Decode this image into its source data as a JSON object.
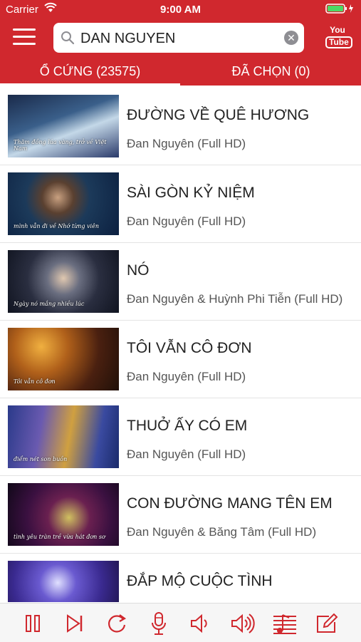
{
  "status": {
    "carrier": "Carrier",
    "time": "9:00 AM"
  },
  "header": {
    "search_value": "DAN NGUYEN",
    "youtube_top": "You",
    "youtube_bottom": "Tube"
  },
  "tabs": [
    {
      "label": "Ổ CỨNG (23575)"
    },
    {
      "label": "ĐÃ CHỌN (0)"
    }
  ],
  "songs": [
    {
      "title": "ĐƯỜNG VỀ QUÊ HƯƠNG",
      "artist": "Đan Nguyên (Full HD)",
      "subtitle": "Thăm đồng lúa vàng, trở về Việt Nam"
    },
    {
      "title": "SÀI GÒN KỶ NIỆM",
      "artist": "Đan Nguyên (Full HD)",
      "subtitle": "mình vẫn đi về  Nhớ từng viên"
    },
    {
      "title": "NÓ",
      "artist": "Đan Nguyên & Huỳnh Phi Tiễn (Full HD)",
      "subtitle": "Ngày nó  mắng nhiều lúc"
    },
    {
      "title": "TÔI VẪN CÔ ĐƠN",
      "artist": "Đan Nguyên (Full HD)",
      "subtitle": "Tôi vẫn cô đơn"
    },
    {
      "title": "THUỞ ẤY CÓ EM",
      "artist": "Đan Nguyên (Full HD)",
      "subtitle": "điểm nét son buồn"
    },
    {
      "title": "CON ĐƯỜNG MANG TÊN EM",
      "artist": "Đan Nguyên & Băng Tâm (Full HD)",
      "subtitle": "tình yêu tràn trề  vừa hát đơn sơ"
    },
    {
      "title": "ĐẮP MỘ CUỘC TÌNH",
      "artist": "",
      "subtitle": ""
    }
  ],
  "colors": {
    "accent": "#d0282e"
  },
  "toolbar_icons": [
    "pause-icon",
    "next-icon",
    "replay-icon",
    "microphone-icon",
    "volume-down-icon",
    "volume-up-icon",
    "playlist-icon",
    "edit-icon"
  ]
}
